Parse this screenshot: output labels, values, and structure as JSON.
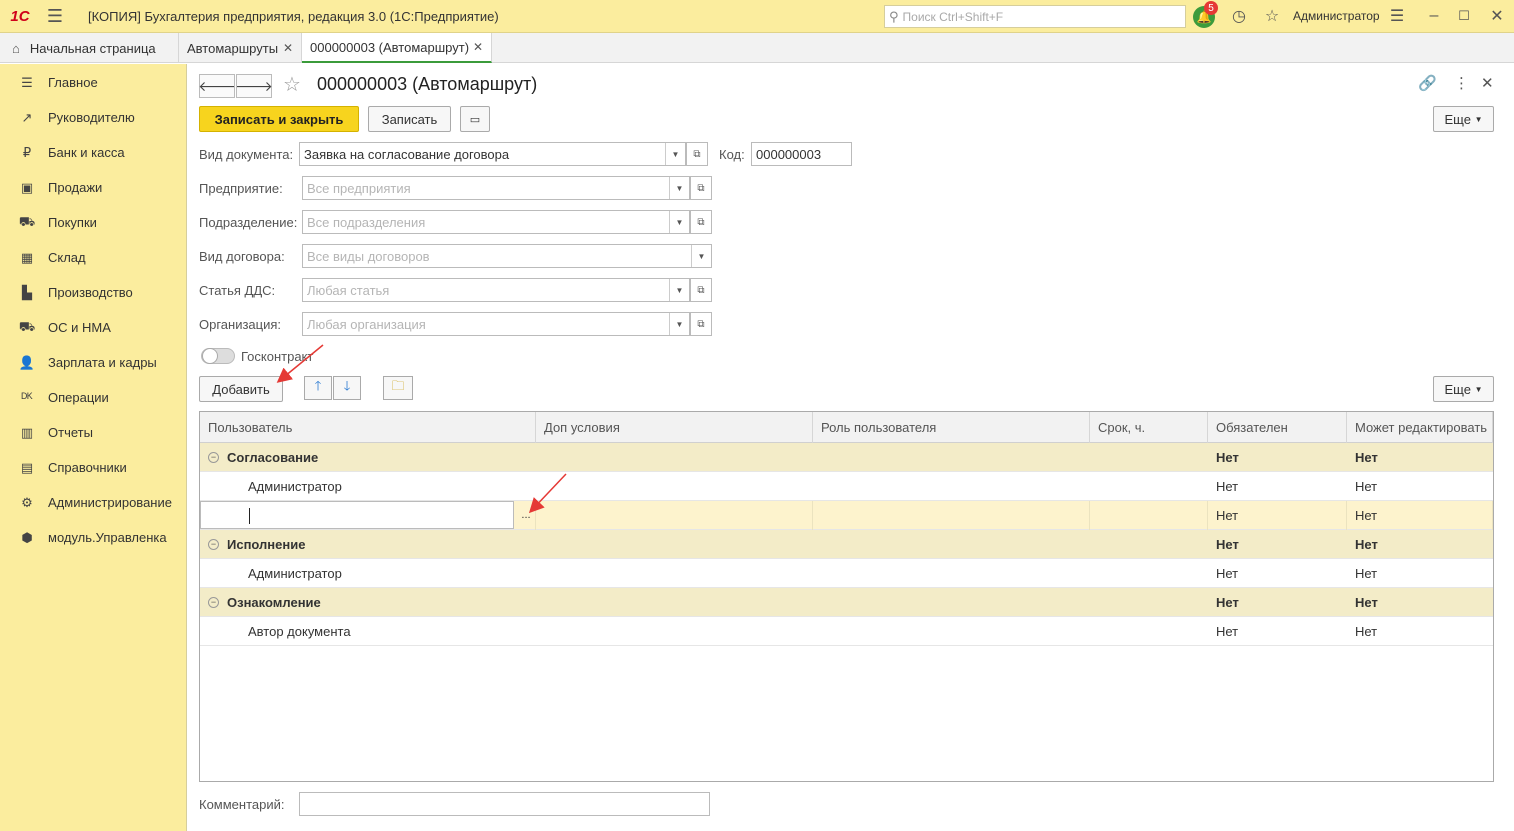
{
  "app": {
    "logo": "1С",
    "title": "[КОПИЯ] Бухгалтерия предприятия, редакция 3.0  (1С:Предприятие)",
    "search_placeholder": "Поиск Ctrl+Shift+F",
    "notifications_count": "5",
    "user": "Администратор"
  },
  "tabs": [
    {
      "label": "Начальная страница"
    },
    {
      "label": "Автомаршруты"
    },
    {
      "label": "000000003 (Автомаршрут)"
    }
  ],
  "sidebar": {
    "items": [
      {
        "label": "Главное",
        "icon": "menu-lines-icon"
      },
      {
        "label": "Руководителю",
        "icon": "trend-icon"
      },
      {
        "label": "Банк и касса",
        "icon": "ruble-icon"
      },
      {
        "label": "Продажи",
        "icon": "bag-icon"
      },
      {
        "label": "Покупки",
        "icon": "cart-icon"
      },
      {
        "label": "Склад",
        "icon": "warehouse-icon"
      },
      {
        "label": "Производство",
        "icon": "factory-icon"
      },
      {
        "label": "ОС и НМА",
        "icon": "truck-icon"
      },
      {
        "label": "Зарплата и кадры",
        "icon": "person-icon"
      },
      {
        "label": "Операции",
        "icon": "dt-kt-icon"
      },
      {
        "label": "Отчеты",
        "icon": "bar-chart-icon"
      },
      {
        "label": "Справочники",
        "icon": "book-icon"
      },
      {
        "label": "Администрирование",
        "icon": "gear-icon"
      },
      {
        "label": "модуль.Управленка",
        "icon": "cube-icon"
      }
    ]
  },
  "form": {
    "title": "000000003 (Автомаршрут)",
    "save_close_label": "Записать и закрыть",
    "save_label": "Записать",
    "more_label": "Еще",
    "doc_type_label": "Вид документа:",
    "doc_type_value": "Заявка на согласование договора",
    "code_label": "Код:",
    "code_value": "000000003",
    "enterprise_label": "Предприятие:",
    "enterprise_placeholder": "Все предприятия",
    "division_label": "Подразделение:",
    "division_placeholder": "Все подразделения",
    "contract_type_label": "Вид договора:",
    "contract_type_placeholder": "Все виды договоров",
    "dds_label": "Статья ДДС:",
    "dds_placeholder": "Любая статья",
    "org_label": "Организация:",
    "org_placeholder": "Любая организация",
    "gov_contract_label": "Госконтракт",
    "add_label": "Добавить",
    "table_more_label": "Еще",
    "comment_label": "Комментарий:",
    "comment_value": ""
  },
  "table": {
    "columns": [
      "Пользователь",
      "Доп условия",
      "Роль пользователя",
      "Срок, ч.",
      "Обязателен",
      "Может редактировать"
    ],
    "rows": [
      {
        "type": "group",
        "user": "Согласование",
        "required": "Нет",
        "editable": "Нет"
      },
      {
        "type": "row",
        "user": "Администратор",
        "required": "Нет",
        "editable": "Нет"
      },
      {
        "type": "edit",
        "user": "",
        "required": "Нет",
        "editable": "Нет"
      },
      {
        "type": "group",
        "user": "Исполнение",
        "required": "Нет",
        "editable": "Нет"
      },
      {
        "type": "row",
        "user": "Администратор",
        "required": "Нет",
        "editable": "Нет"
      },
      {
        "type": "group",
        "user": "Ознакомление",
        "required": "Нет",
        "editable": "Нет"
      },
      {
        "type": "row",
        "user": "Автор документа",
        "required": "Нет",
        "editable": "Нет"
      }
    ]
  },
  "colors": {
    "accent_yellow": "#fbed9e",
    "primary_button": "#f7d41e",
    "group_row": "#f3ecc8",
    "active_tab_underline": "#3b9b3b",
    "annotation_arrow": "#e53935"
  }
}
